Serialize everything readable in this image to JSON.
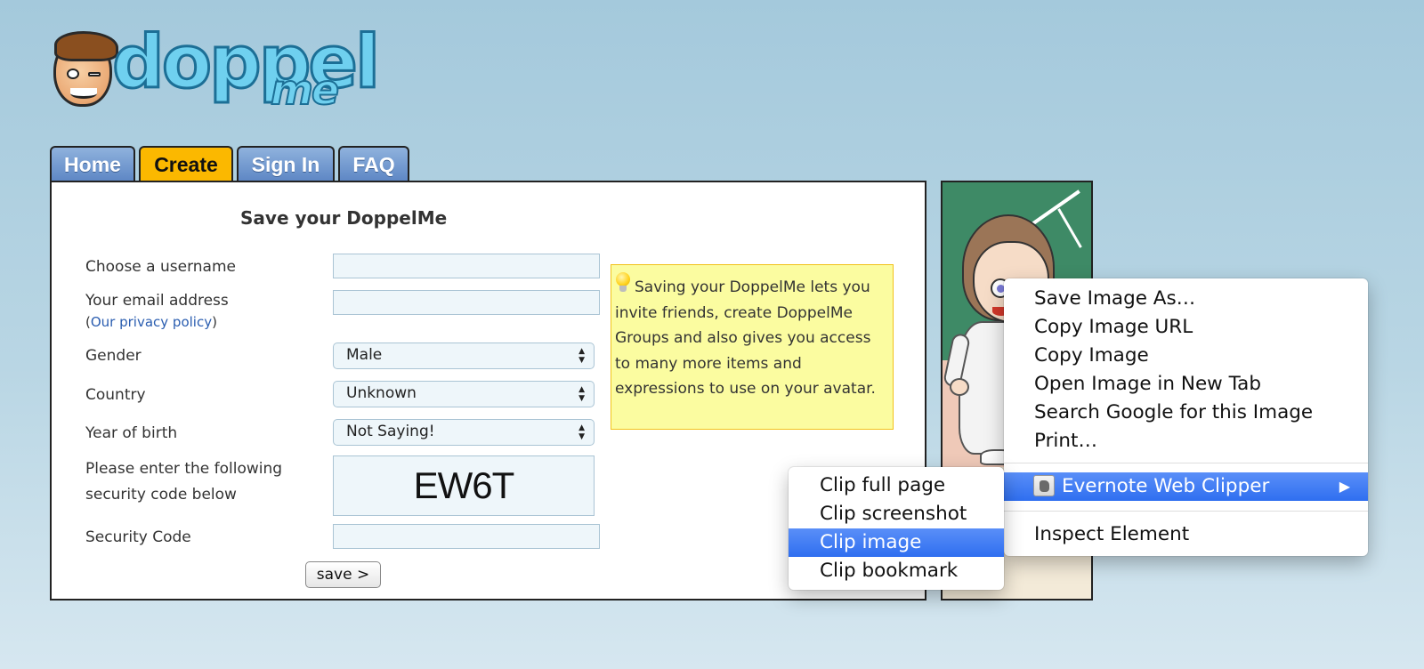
{
  "brand": {
    "logo_text": "doppel",
    "logo_sub": "me"
  },
  "tabs": [
    {
      "label": "Home",
      "active": false
    },
    {
      "label": "Create",
      "active": true
    },
    {
      "label": "Sign In",
      "active": false
    },
    {
      "label": "FAQ",
      "active": false
    }
  ],
  "form": {
    "title": "Save your DoppelMe",
    "username_label": "Choose a username",
    "username_value": "",
    "email_label": "Your email address",
    "privacy_open": "(",
    "privacy_link": "Our privacy policy",
    "privacy_close": ")",
    "email_value": "",
    "gender_label": "Gender",
    "gender_value": "Male",
    "country_label": "Country",
    "country_value": "Unknown",
    "year_label": "Year of birth",
    "year_value": "Not Saying!",
    "captcha_label_line1": "Please enter the following",
    "captcha_label_line2": "security code below",
    "captcha_code": "EW6T",
    "security_label": "Security Code",
    "security_value": "",
    "save_label": "save >"
  },
  "note": {
    "text": "Saving your DoppelMe lets you invite friends, create DoppelMe Groups and also gives you access to many more items and expressions to use on your avatar.",
    "icon": "lightbulb-icon"
  },
  "context_menu": {
    "items": [
      "Save Image As…",
      "Copy Image URL",
      "Copy Image",
      "Open Image in New Tab",
      "Search Google for this Image",
      "Print…"
    ],
    "evernote_label": "Evernote Web Clipper",
    "inspect_label": "Inspect Element",
    "highlight_color": "#3a78f2"
  },
  "submenu": {
    "items": [
      {
        "label": "Clip full page",
        "highlighted": false
      },
      {
        "label": "Clip screenshot",
        "highlighted": false
      },
      {
        "label": "Clip image",
        "highlighted": true
      },
      {
        "label": "Clip bookmark",
        "highlighted": false
      }
    ]
  },
  "colors": {
    "tab_active": "#fbb800",
    "tab_inactive": "#6f95cf",
    "note_bg": "#fbfca0",
    "link": "#2a5db0"
  }
}
